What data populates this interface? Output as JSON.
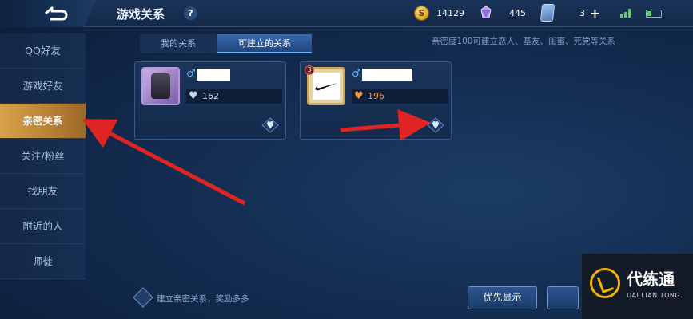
{
  "header": {
    "title": "游戏关系",
    "help": "?",
    "resources": {
      "coins": "14129",
      "gems": "445",
      "cards": "3",
      "coin_symbol": "S"
    }
  },
  "sidebar": {
    "items": [
      {
        "label": "QQ好友"
      },
      {
        "label": "游戏好友"
      },
      {
        "label": "亲密关系",
        "active": true
      },
      {
        "label": "关注/粉丝"
      },
      {
        "label": "找朋友"
      },
      {
        "label": "附近的人"
      },
      {
        "label": "师徒"
      }
    ]
  },
  "tabs": [
    {
      "label": "我的关系"
    },
    {
      "label": "可建立的关系",
      "active": true
    }
  ],
  "info_note": "亲密度100可建立恋人、基友、闺蜜、死党等关系",
  "cards": [
    {
      "gender": "♂",
      "intimacy": "162"
    },
    {
      "gender": "♂",
      "intimacy": "196",
      "rank_badge": "3"
    }
  ],
  "bottom": {
    "hint": "建立亲密关系，奖励多多",
    "priority_button": "优先显示"
  },
  "watermark": {
    "title": "代练通",
    "subtitle": "DAI LIAN TONG"
  },
  "colors": {
    "accent_active": "#d8a24b",
    "arrow": "#e02424",
    "intimacy_orange": "#f39540"
  }
}
